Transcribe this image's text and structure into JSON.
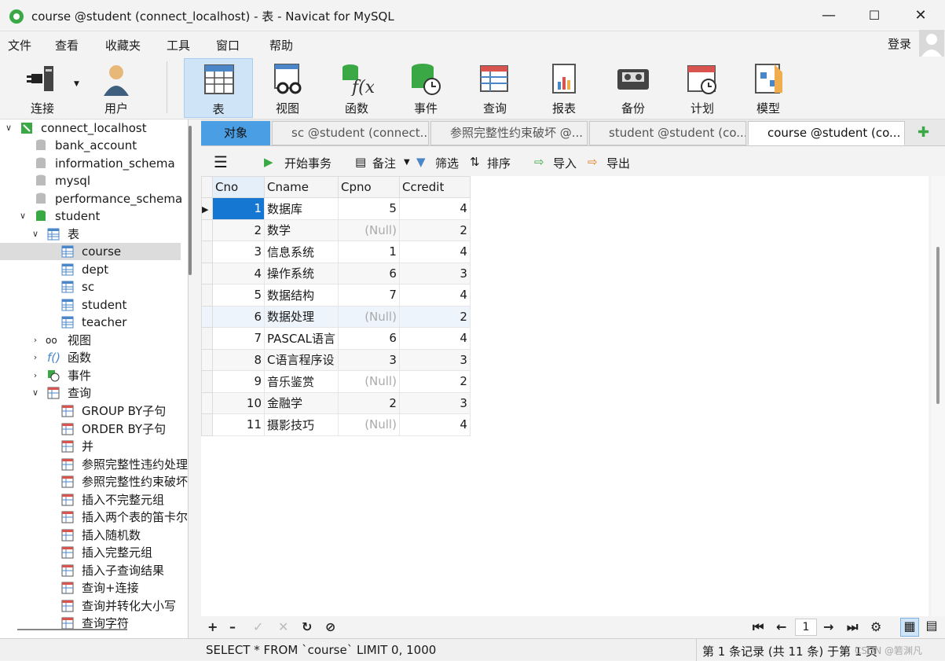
{
  "window": {
    "title": "course @student (connect_localhost) - 表 - Navicat for MySQL"
  },
  "menu": [
    "文件",
    "查看",
    "收藏夹",
    "工具",
    "窗口",
    "帮助"
  ],
  "login": "登录",
  "toolbar": [
    "连接",
    "用户",
    "表",
    "视图",
    "函数",
    "事件",
    "查询",
    "报表",
    "备份",
    "计划",
    "模型"
  ],
  "tree": {
    "connection": "connect_localhost",
    "databases": [
      "bank_account",
      "information_schema",
      "mysql",
      "performance_schema",
      "student"
    ],
    "tables_folder": "表",
    "tables": [
      "course",
      "dept",
      "sc",
      "student",
      "teacher"
    ],
    "folders": [
      "视图",
      "函数",
      "事件",
      "查询"
    ],
    "queries": [
      "GROUP BY子句",
      "ORDER BY子句",
      "并",
      "参照完整性违约处理",
      "参照完整性约束破坏",
      "插入不完整元组",
      "插入两个表的笛卡尔",
      "插入随机数",
      "插入完整元组",
      "插入子查询结果",
      "查询+连接",
      "查询并转化大小写",
      "查询字符"
    ]
  },
  "tabs": [
    "对象",
    "sc @student (connect...",
    "参照完整性约束破坏 @...",
    "student @student (co...",
    "course @student (co..."
  ],
  "subtoolbar": {
    "begin_tx": "开始事务",
    "note": "备注",
    "filter": "筛选",
    "sort": "排序",
    "import": "导入",
    "export": "导出"
  },
  "grid": {
    "columns": [
      "Cno",
      "Cname",
      "Cpno",
      "Ccredit"
    ],
    "rows": [
      [
        "1",
        "数据库",
        "5",
        "4"
      ],
      [
        "2",
        "数学",
        "(Null)",
        "2"
      ],
      [
        "3",
        "信息系统",
        "1",
        "4"
      ],
      [
        "4",
        "操作系统",
        "6",
        "3"
      ],
      [
        "5",
        "数据结构",
        "7",
        "4"
      ],
      [
        "6",
        "数据处理",
        "(Null)",
        "2"
      ],
      [
        "7",
        "PASCAL语言",
        "6",
        "4"
      ],
      [
        "8",
        "C语言程序设",
        "3",
        "3"
      ],
      [
        "9",
        "音乐鉴赏",
        "(Null)",
        "2"
      ],
      [
        "10",
        "金融学",
        "2",
        "3"
      ],
      [
        "11",
        "摄影技巧",
        "(Null)",
        "4"
      ]
    ]
  },
  "nav": {
    "page": "1"
  },
  "status": {
    "sql": "SELECT * FROM `course` LIMIT 0, 1000",
    "records": "第 1 条记录 (共 11 条) 于第 1 页",
    "watermark": "CSDN @箬渊凡"
  }
}
